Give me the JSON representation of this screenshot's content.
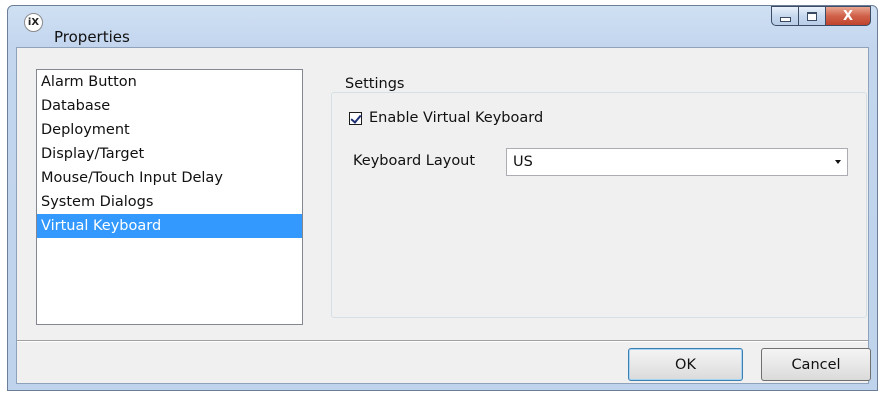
{
  "window": {
    "title": "Properties",
    "app_icon_text": "iX",
    "close_glyph": "X"
  },
  "categories": [
    {
      "label": "Alarm Button",
      "selected": false
    },
    {
      "label": "Database",
      "selected": false
    },
    {
      "label": "Deployment",
      "selected": false
    },
    {
      "label": "Display/Target",
      "selected": false
    },
    {
      "label": "Mouse/Touch Input Delay",
      "selected": false
    },
    {
      "label": "System Dialogs",
      "selected": false
    },
    {
      "label": "Virtual Keyboard",
      "selected": true
    }
  ],
  "settings": {
    "group_title": "Settings",
    "enable_virtual_keyboard": {
      "label": "Enable Virtual Keyboard",
      "checked": true
    },
    "keyboard_layout": {
      "label": "Keyboard Layout",
      "value": "US"
    }
  },
  "buttons": {
    "ok": "OK",
    "cancel": "Cancel"
  },
  "colors": {
    "selection": "#3399ff",
    "title_bar": "#c3d6ee",
    "close_button": "#c0432c"
  }
}
